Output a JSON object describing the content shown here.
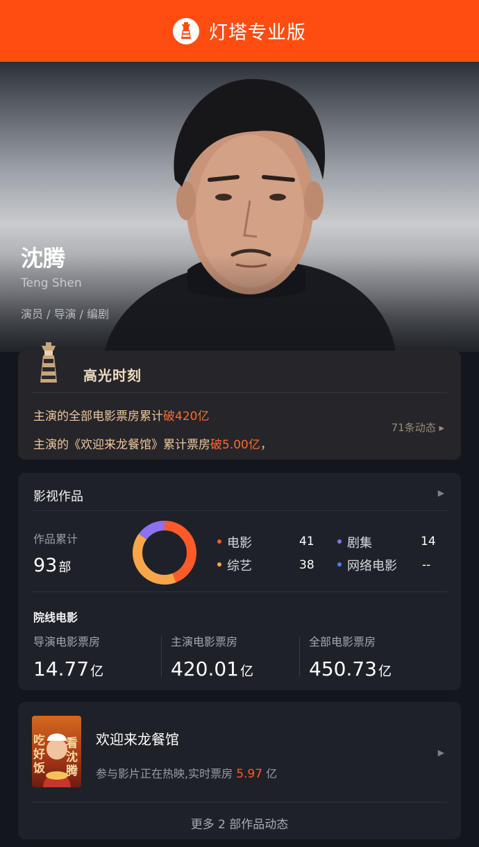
{
  "app": {
    "title": "灯塔专业版",
    "logo_icon": "lighthouse-icon",
    "brand_color": "#ff4d12"
  },
  "profile": {
    "name": "沈腾",
    "english_name": "Teng Shen",
    "roles": "演员 / 导演 / 编剧"
  },
  "highlight": {
    "title": "高光时刻",
    "line1_prefix": "主演的全部电影票房累计",
    "line1_highlight": "破420亿",
    "line2_prefix": "主演的《欢迎来龙餐馆》累计票房",
    "line2_highlight": "破5.00亿",
    "line2_suffix": "，",
    "more": "71条动态 ▸"
  },
  "works": {
    "title": "影视作品",
    "total_label": "作品累计",
    "total_value": "93",
    "total_unit": "部",
    "legend": [
      {
        "label": "电影",
        "value": "41",
        "color": "#ff5a2a"
      },
      {
        "label": "综艺",
        "value": "38",
        "color": "#f7a64a"
      },
      {
        "label": "剧集",
        "value": "14",
        "color": "#8c72f0"
      },
      {
        "label": "网络电影",
        "value": "--",
        "color": "#4a7ff0"
      }
    ],
    "theater_title": "院线电影",
    "box_office": [
      {
        "label": "导演电影票房",
        "value": "14.77",
        "unit": "亿"
      },
      {
        "label": "主演电影票房",
        "value": "420.01",
        "unit": "亿"
      },
      {
        "label": "全部电影票房",
        "value": "450.73",
        "unit": "亿"
      }
    ]
  },
  "chart_data": {
    "type": "pie",
    "categories": [
      "电影",
      "综艺",
      "剧集",
      "网络电影"
    ],
    "values": [
      41,
      38,
      14,
      0
    ],
    "colors": [
      "#ff5a2a",
      "#f7a64a",
      "#8c72f0",
      "#4a7ff0"
    ]
  },
  "movie": {
    "title": "欢迎来龙餐馆",
    "poster_text_left": "吃好饭",
    "poster_text_right": "看沈腾",
    "desc_prefix": "参与影片正在热映,实时票房",
    "live_box_office": "5.97",
    "desc_unit": "亿",
    "more": "更多 2 部作品动态"
  }
}
